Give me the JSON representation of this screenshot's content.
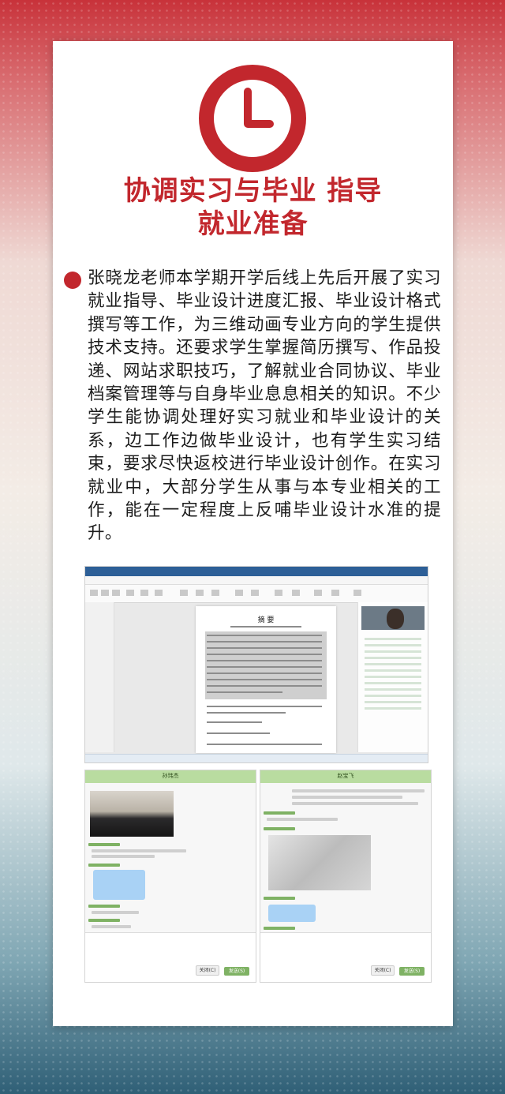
{
  "title": {
    "line1": "协调实习与毕业 指导",
    "line2": "就业准备"
  },
  "body": "张晓龙老师本学期开学后线上先后开展了实习就业指导、毕业设计进度汇报、毕业设计格式撰写等工作，为三维动画专业方向的学生提供技术支持。还要求学生掌握简历撰写、作品投递、网站求职技巧，了解就业合同协议、毕业档案管理等与自身毕业息息相关的知识。不少学生能协调处理好实习就业和毕业设计的关系，边工作边做毕业设计，也有学生实习结束，要求尽快返校进行毕业设计创作。在实习就业中，大部分学生从事与本专业相关的工作，能在一定程度上反哺毕业设计水准的提升。",
  "colors": {
    "accent": "#c2272d",
    "chat_header": "#b9dca0",
    "send_button": "#7fb264"
  },
  "icons": {
    "top": "clock-icon",
    "bullet": "red-dot-bullet"
  },
  "screenshots": {
    "document_title": "摘 要",
    "chat_left_name": "孙玮杰",
    "chat_right_name": "赵宝飞",
    "close_button": "关闭(C)",
    "send_button": "发送(S)"
  }
}
